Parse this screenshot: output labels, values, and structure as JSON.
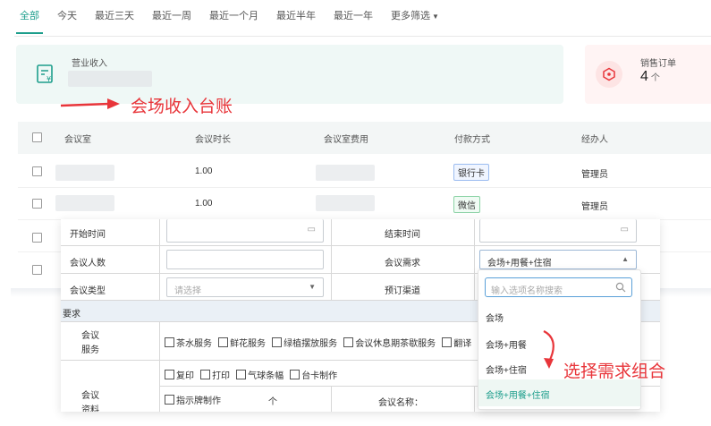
{
  "tabs": [
    "全部",
    "今天",
    "最近三天",
    "最近一周",
    "最近一个月",
    "最近半年",
    "最近一年",
    "更多筛选"
  ],
  "summary": {
    "income_label": "营业收入",
    "orders_label": "销售订单",
    "orders_value": "4",
    "orders_unit": "个"
  },
  "annotation_ledger": "会场收入台账",
  "table": {
    "headers": [
      "会议室",
      "会议时长",
      "会议室费用",
      "付款方式",
      "经办人"
    ],
    "rows": [
      {
        "duration": "1.00",
        "payment": "银行卡",
        "operator": "管理员"
      },
      {
        "duration": "1.00",
        "payment": "微信",
        "operator": "管理员"
      }
    ]
  },
  "form": {
    "start_time_label": "开始时间",
    "end_time_label": "结束时间",
    "attendees_label": "会议人数",
    "needs_label": "会议需求",
    "needs_value": "会场+用餐+住宿",
    "type_label": "会议类型",
    "type_placeholder": "请选择",
    "channel_label": "预订渠道",
    "section_label": "要求",
    "service_label_1": "会议",
    "service_label_2": "服务",
    "services": [
      "茶水服务",
      "鲜花服务",
      "绿植摆放服务",
      "会议休息期茶歇服务",
      "翻译"
    ],
    "materials": [
      "复印",
      "打印",
      "气球条幅",
      "台卡制作"
    ],
    "material_label_1": "会议",
    "material_label_2": "资料",
    "sign_label": "指示牌制作",
    "sign_unit": "个",
    "meeting_name_label": "会议名称："
  },
  "dropdown": {
    "search_placeholder": "输入选项名称搜索",
    "options": [
      "会场",
      "会场+用餐",
      "会场+住宿",
      "会场+用餐+住宿"
    ],
    "selected_index": 3
  },
  "annotation_combo": "选择需求组合",
  "colors": {
    "accent": "#1d9e8c",
    "annotation": "#e8353a",
    "bank_tag": "#2f6fd8",
    "wechat_tag": "#1f9e4f"
  }
}
